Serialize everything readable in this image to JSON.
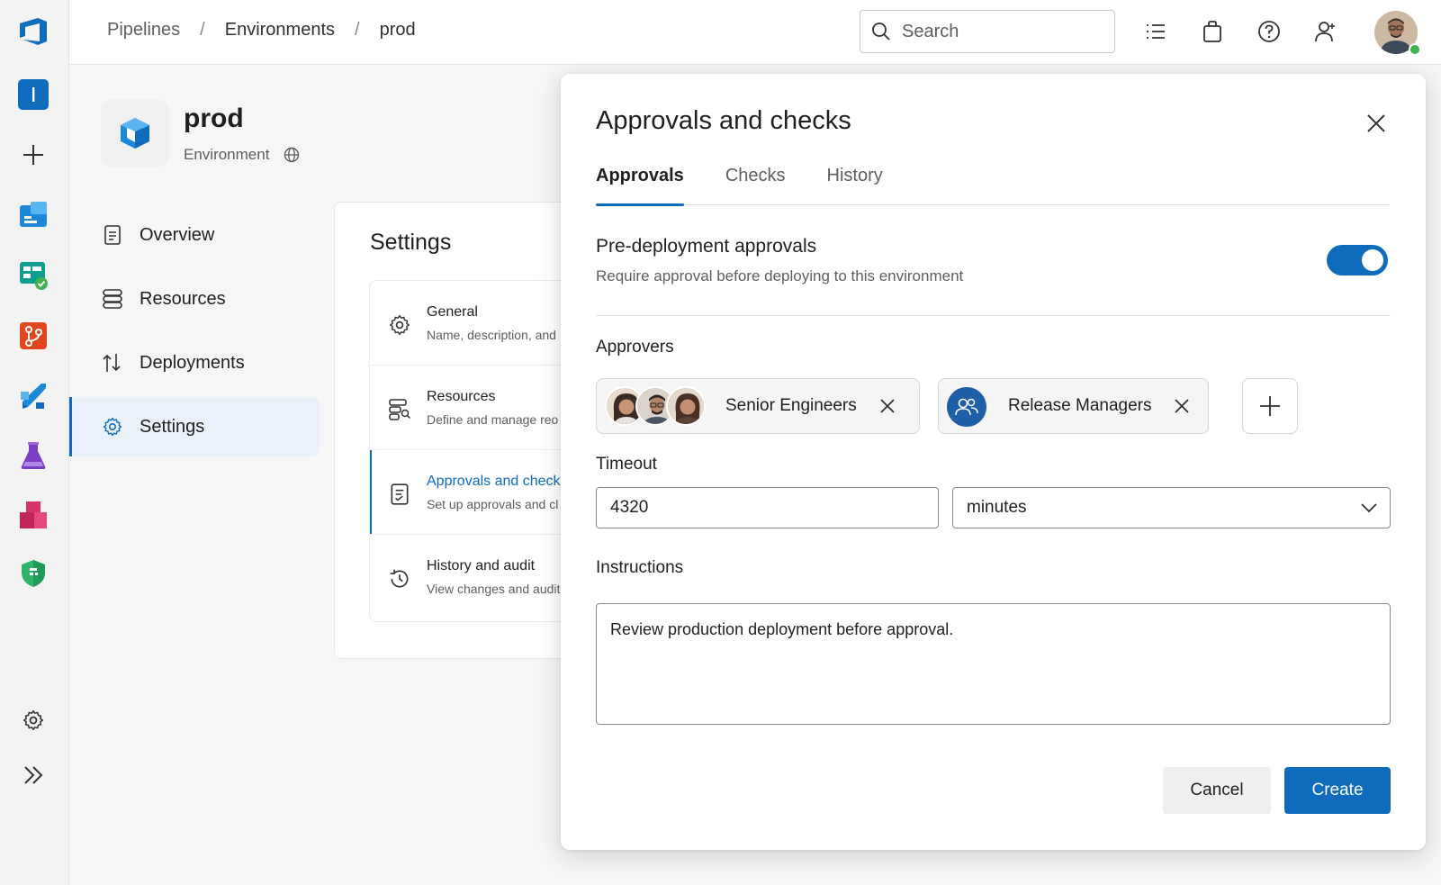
{
  "breadcrumb": [
    "Pipelines",
    "Environments",
    "prod"
  ],
  "search": {
    "placeholder": "Search"
  },
  "header_icons": [
    "task-list-icon",
    "shopping-bag-icon",
    "help-icon",
    "user-settings-icon"
  ],
  "environment": {
    "name": "prod",
    "type": "Environment"
  },
  "nav": {
    "items": [
      {
        "label": "Overview",
        "icon": "overview-icon"
      },
      {
        "label": "Resources",
        "icon": "resources-icon"
      },
      {
        "label": "Deployments",
        "icon": "deployments-icon"
      },
      {
        "label": "Settings",
        "icon": "settings-icon",
        "active": true
      }
    ]
  },
  "settings": {
    "title": "Settings",
    "items": [
      {
        "title": "General",
        "desc": "Name, description, and"
      },
      {
        "title": "Resources",
        "desc": "Define and manage reo"
      },
      {
        "title": "Approvals and checks",
        "desc": "Set up approvals and cl",
        "active": true
      },
      {
        "title": "History and audit",
        "desc": "View changes and audit"
      }
    ]
  },
  "dialog": {
    "title": "Approvals and checks",
    "tabs": [
      {
        "label": "Approvals",
        "active": true
      },
      {
        "label": "Checks"
      },
      {
        "label": "History"
      }
    ],
    "pre_deployment": {
      "title": "Pre-deployment approvals",
      "description": "Require approval before deploying to this environment",
      "enabled": true
    },
    "approvers": {
      "label": "Approvers",
      "groups": [
        "Senior Engineers",
        "Release Managers"
      ]
    },
    "timeout": {
      "label": "Timeout",
      "value": "4320",
      "unit": "minutes"
    },
    "instructions": {
      "label": "Instructions",
      "value": "Review production deployment before approval."
    },
    "buttons": {
      "cancel": "Cancel",
      "create": "Create"
    }
  },
  "colors": {
    "accent": "#0f6cbd",
    "presence": "#3fb34f"
  }
}
